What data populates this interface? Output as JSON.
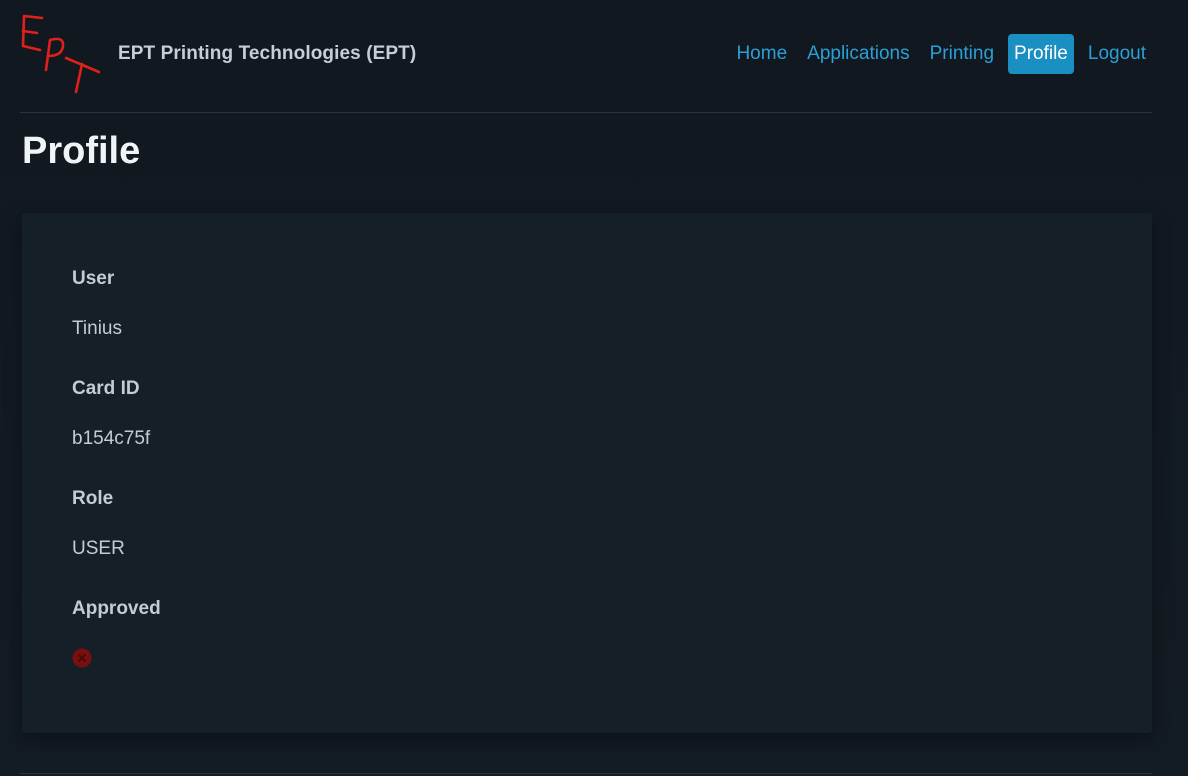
{
  "header": {
    "logo_text": "EPT",
    "brand": "EPT Printing Technologies (EPT)",
    "nav": [
      {
        "label": "Home",
        "active": false
      },
      {
        "label": "Applications",
        "active": false
      },
      {
        "label": "Printing",
        "active": false
      },
      {
        "label": "Profile",
        "active": true
      },
      {
        "label": "Logout",
        "active": false
      }
    ]
  },
  "page": {
    "title": "Profile"
  },
  "profile": {
    "user_label": "User",
    "user_value": "Tinius",
    "card_id_label": "Card ID",
    "card_id_value": "b154c75f",
    "role_label": "Role",
    "role_value": "USER",
    "approved_label": "Approved",
    "approved_icon": "x-circle-icon",
    "approved_value": false
  },
  "colors": {
    "background": "#121a22",
    "card": "#151f28",
    "link": "#2aa0d6",
    "active_nav": "#1a8fc1",
    "logo_red": "#e0201a",
    "denied_red": "#7a0f0f"
  }
}
